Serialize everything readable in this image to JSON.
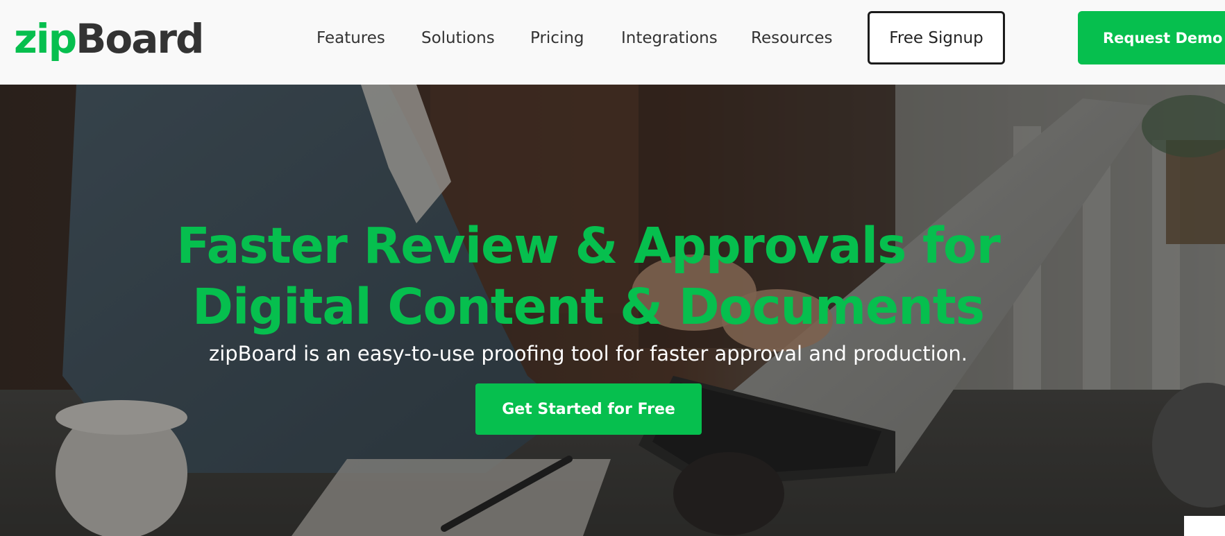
{
  "header": {
    "logo": {
      "part1": "zip",
      "part2": "Board"
    },
    "nav": [
      "Features",
      "Solutions",
      "Pricing",
      "Integrations",
      "Resources"
    ],
    "signup_label": "Free Signup",
    "demo_label": "Request Demo"
  },
  "hero": {
    "headline_line1": "Faster Review & Approvals for",
    "headline_line2": "Digital Content & Documents",
    "subheadline": "zipBoard is an easy-to-use proofing tool for faster approval and production.",
    "cta_label": "Get Started for Free"
  },
  "colors": {
    "brand_green": "#06bf4e",
    "text_dark": "#333333",
    "header_bg": "#f9f9f9"
  }
}
